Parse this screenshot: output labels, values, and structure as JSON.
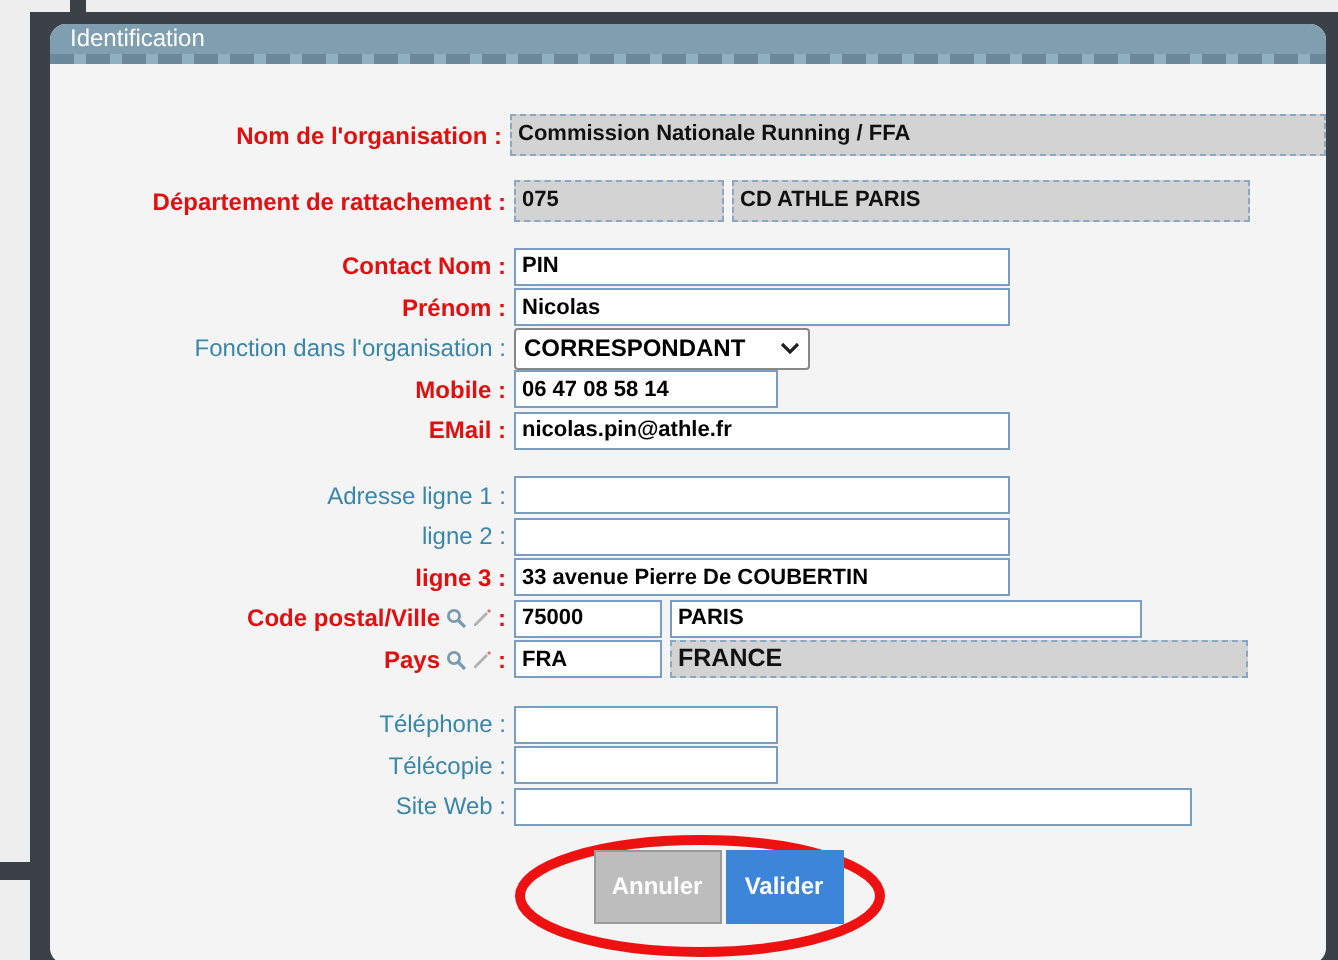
{
  "panel": {
    "title": "Identification"
  },
  "groups": [
    [
      {
        "label": "Nom de l'organisation :",
        "required": true,
        "lookup": false,
        "kind": "text",
        "inputs": [
          {
            "value": "Commission Nationale Running / FFA",
            "readonly": true
          }
        ]
      },
      {
        "label": "Département de rattachement :",
        "required": true,
        "lookup": false,
        "kind": "text",
        "inputs": [
          {
            "value": "075",
            "readonly": true
          },
          {
            "value": "CD ATHLE PARIS",
            "readonly": true
          }
        ]
      }
    ],
    [
      {
        "label": "Contact Nom :",
        "required": true,
        "lookup": false,
        "kind": "text",
        "inputs": [
          {
            "value": "PIN",
            "readonly": false
          }
        ]
      },
      {
        "label": "Prénom :",
        "required": true,
        "lookup": false,
        "kind": "text",
        "inputs": [
          {
            "value": "Nicolas",
            "readonly": false
          }
        ]
      },
      {
        "label": "Fonction dans l'organisation :",
        "required": false,
        "lookup": false,
        "kind": "select",
        "inputs": [
          {
            "value": "CORRESPONDANT"
          }
        ]
      },
      {
        "label": "Mobile :",
        "required": true,
        "lookup": false,
        "kind": "text",
        "inputs": [
          {
            "value": "06 47 08 58 14",
            "readonly": false
          }
        ]
      },
      {
        "label": "EMail :",
        "required": true,
        "lookup": false,
        "kind": "text",
        "inputs": [
          {
            "value": "nicolas.pin@athle.fr",
            "readonly": false
          }
        ]
      }
    ],
    [
      {
        "label": "Adresse ligne 1 :",
        "required": false,
        "lookup": false,
        "kind": "text",
        "inputs": [
          {
            "readonly": false
          }
        ]
      },
      {
        "label": "ligne 2 :",
        "required": false,
        "lookup": false,
        "kind": "text",
        "inputs": [
          {
            "readonly": false
          }
        ]
      },
      {
        "label": "ligne 3 :",
        "required": true,
        "lookup": false,
        "kind": "text",
        "inputs": [
          {
            "value": "33 avenue Pierre De COUBERTIN",
            "readonly": false
          }
        ]
      },
      {
        "label": "Code postal/Ville",
        "required": true,
        "lookup": true,
        "kind": "text",
        "inputs": [
          {
            "value": "75000",
            "readonly": false
          },
          {
            "value": "PARIS",
            "readonly": false
          }
        ]
      },
      {
        "label": "Pays",
        "required": true,
        "lookup": true,
        "kind": "text",
        "inputs": [
          {
            "value": "FRA",
            "readonly": false
          },
          {
            "value": "FRANCE",
            "readonly": true
          }
        ]
      }
    ],
    [
      {
        "label": "Téléphone :",
        "required": false,
        "lookup": false,
        "kind": "text",
        "inputs": [
          {
            "readonly": false
          }
        ]
      },
      {
        "label": "Télécopie :",
        "required": false,
        "lookup": false,
        "kind": "text",
        "inputs": [
          {
            "readonly": false
          }
        ]
      },
      {
        "label": "Site Web :",
        "required": false,
        "lookup": false,
        "kind": "text",
        "inputs": [
          {
            "readonly": false
          }
        ]
      }
    ]
  ],
  "buttons": [
    {
      "label": "Annuler",
      "kind": "cancel"
    },
    {
      "label": "Valider",
      "kind": "primary"
    }
  ],
  "lookup_separator": ":"
}
